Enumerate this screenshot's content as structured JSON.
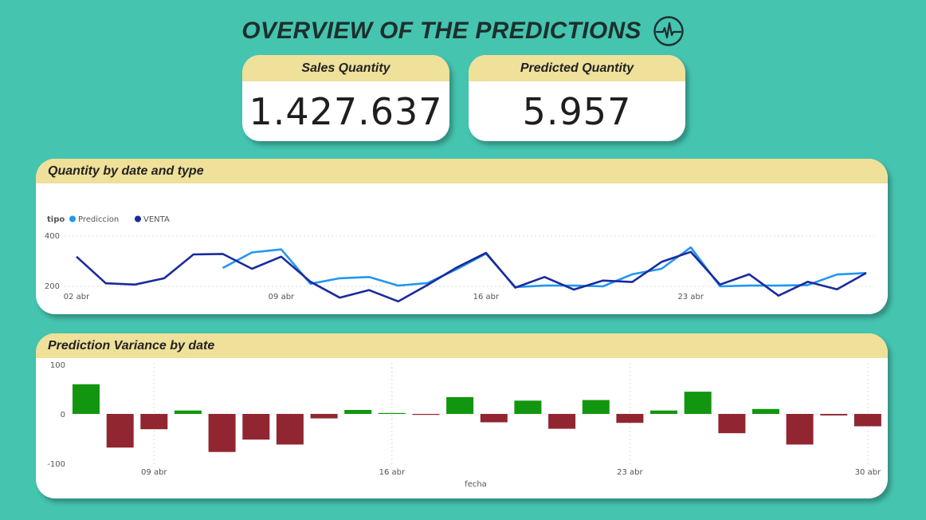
{
  "header": {
    "title": "OVERVIEW OF THE PREDICTIONS",
    "icon": "heartbeat-icon"
  },
  "kpis": [
    {
      "label": "Sales Quantity",
      "value": "1.427.637"
    },
    {
      "label": "Predicted Quantity",
      "value": "5.957"
    }
  ],
  "colors": {
    "background": "#45c4b0",
    "header_band": "#efe09a",
    "prediccion": "#2196f3",
    "venta": "#1a2b9c",
    "positive": "#12960f",
    "negative": "#912631"
  },
  "chart_data": [
    {
      "type": "line",
      "title": "Quantity by date and type",
      "legend_title": "tipo",
      "legend_position": "top-left",
      "grid": true,
      "ylim": [
        150,
        400
      ],
      "yticks": [
        200,
        400
      ],
      "xlabel": "",
      "ylabel": "",
      "x_tick_labels": [
        "02 abr",
        "09 abr",
        "16 abr",
        "23 abr"
      ],
      "series": [
        {
          "name": "VENTA",
          "color": "#1a2b9c",
          "points": [
            [
              "02 abr",
              318
            ],
            [
              "03 abr",
              212
            ],
            [
              "04 abr",
              207
            ],
            [
              "05 abr",
              232
            ],
            [
              "06 abr",
              327
            ],
            [
              "07 abr",
              329
            ],
            [
              "08 abr",
              270
            ],
            [
              "09 abr",
              318
            ],
            [
              "10 abr",
              218
            ],
            [
              "11 abr",
              155
            ],
            [
              "12 abr",
              185
            ],
            [
              "13 abr",
              140
            ],
            [
              "14 abr",
              205
            ],
            [
              "15 abr",
              275
            ],
            [
              "16 abr",
              333
            ],
            [
              "17 abr",
              195
            ],
            [
              "18 abr",
              237
            ],
            [
              "19 abr",
              187
            ],
            [
              "20 abr",
              223
            ],
            [
              "21 abr",
              217
            ],
            [
              "22 abr",
              297
            ],
            [
              "23 abr",
              337
            ],
            [
              "24 abr",
              207
            ],
            [
              "25 abr",
              248
            ],
            [
              "26 abr",
              163
            ],
            [
              "27 abr",
              218
            ],
            [
              "28 abr",
              188
            ],
            [
              "29 abr",
              253
            ]
          ]
        },
        {
          "name": "Prediccion",
          "color": "#2196f3",
          "points": [
            [
              "07 abr",
              273
            ],
            [
              "08 abr",
              335
            ],
            [
              "09 abr",
              347
            ],
            [
              "10 abr",
              210
            ],
            [
              "11 abr",
              232
            ],
            [
              "12 abr",
              237
            ],
            [
              "13 abr",
              203
            ],
            [
              "14 abr",
              213
            ],
            [
              "15 abr",
              268
            ],
            [
              "16 abr",
              330
            ],
            [
              "17 abr",
              197
            ],
            [
              "18 abr",
              203
            ],
            [
              "19 abr",
              203
            ],
            [
              "20 abr",
              200
            ],
            [
              "21 abr",
              248
            ],
            [
              "22 abr",
              270
            ],
            [
              "23 abr",
              355
            ],
            [
              "24 abr",
              200
            ],
            [
              "25 abr",
              203
            ],
            [
              "26 abr",
              203
            ],
            [
              "27 abr",
              205
            ],
            [
              "28 abr",
              247
            ],
            [
              "29 abr",
              253
            ]
          ]
        }
      ]
    },
    {
      "type": "bar",
      "title": "Prediction Variance by date",
      "xlabel": "fecha",
      "ylabel": "",
      "ylim": [
        -100,
        100
      ],
      "yticks": [
        -100,
        0,
        100
      ],
      "grid": true,
      "x_tick_labels": [
        "09 abr",
        "16 abr",
        "23 abr",
        "30 abr"
      ],
      "categories": [
        "07 abr",
        "08 abr",
        "09 abr",
        "10 abr",
        "11 abr",
        "12 abr",
        "13 abr",
        "14 abr",
        "15 abr",
        "16 abr",
        "17 abr",
        "18 abr",
        "19 abr",
        "20 abr",
        "21 abr",
        "22 abr",
        "23 abr",
        "24 abr",
        "25 abr",
        "26 abr",
        "27 abr",
        "28 abr",
        "29 abr",
        "30 abr"
      ],
      "values": [
        60,
        -68,
        -31,
        7,
        -77,
        -52,
        -62,
        -9,
        8,
        2,
        -2,
        34,
        -17,
        27,
        -30,
        28,
        -18,
        7,
        45,
        -39,
        10,
        -62,
        -3,
        -25
      ]
    }
  ]
}
